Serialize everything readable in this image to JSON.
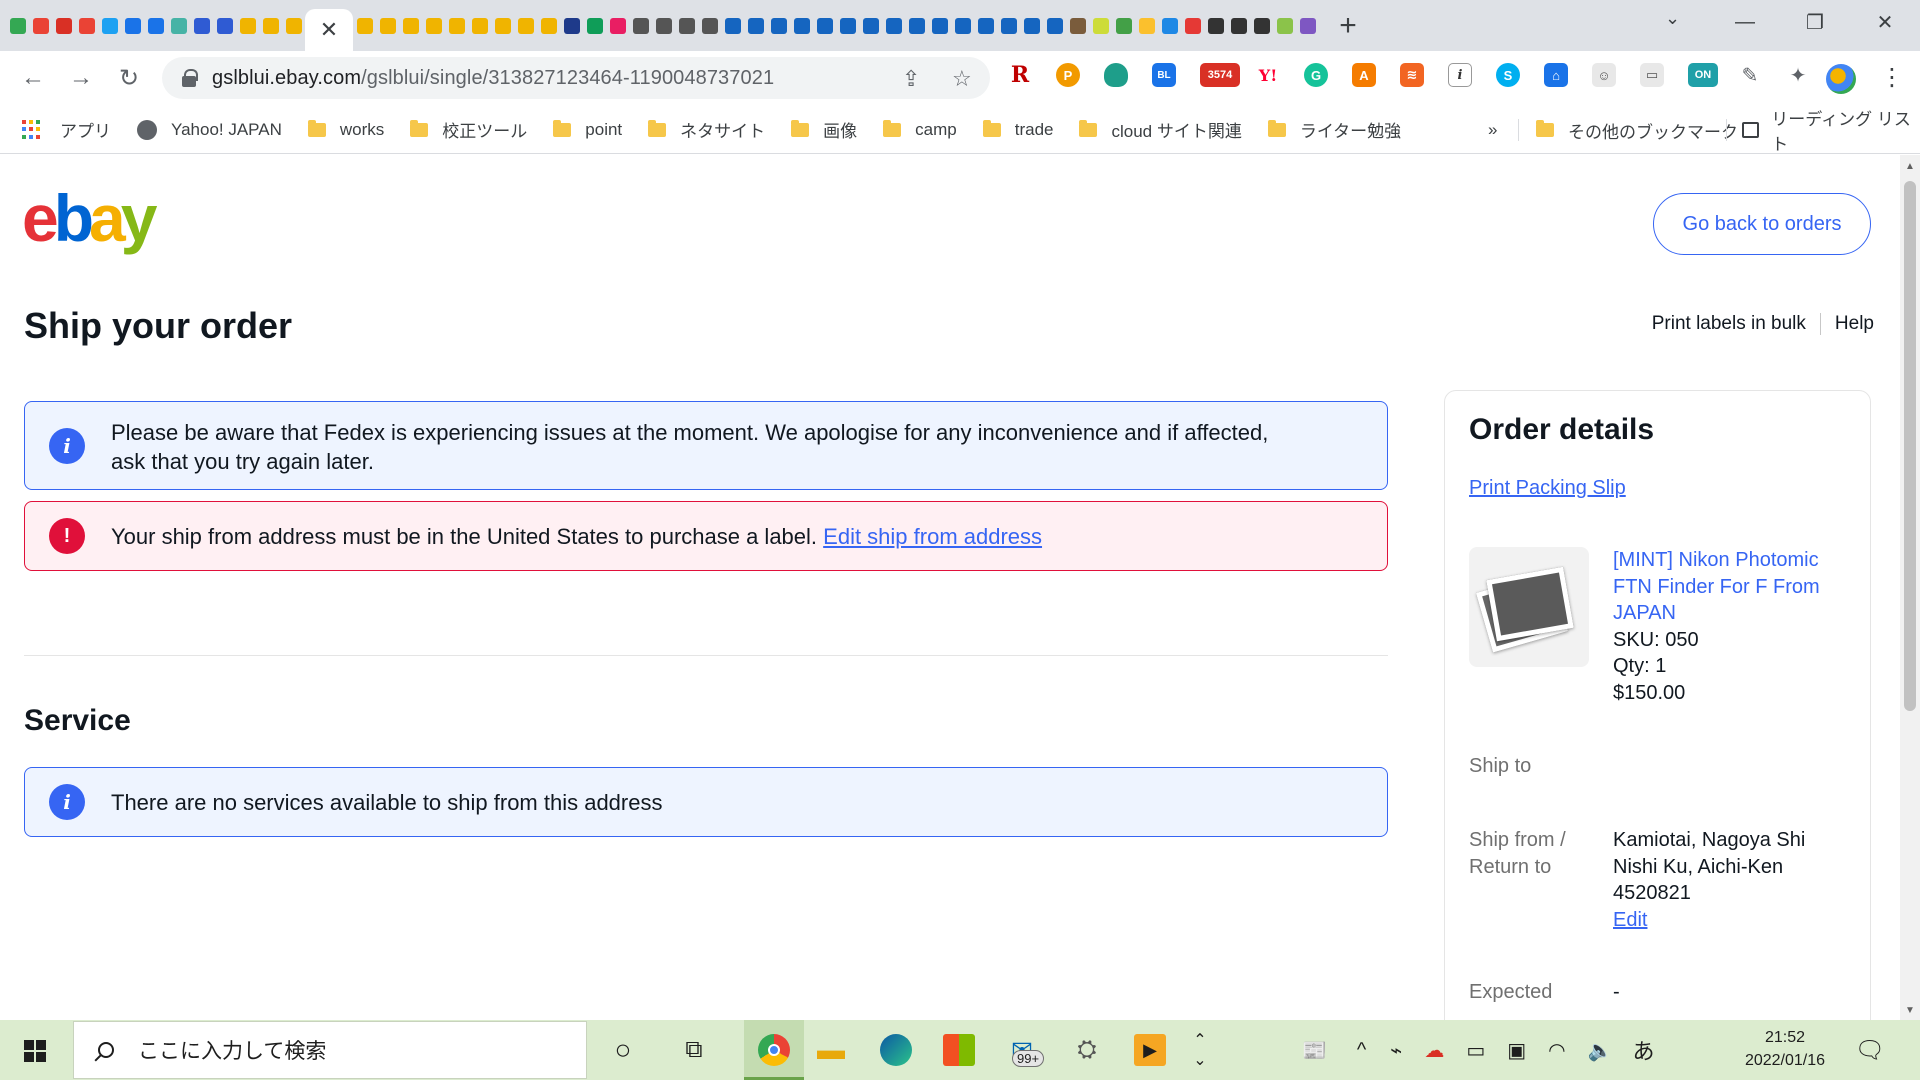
{
  "browser": {
    "active_tab_close": "✕",
    "new_tab": "+",
    "url_host": "gslblui.ebay.com",
    "url_path": "/gslblui/single/313827123464-1190048737021",
    "bookmarks": [
      {
        "label": "アプリ",
        "type": "apps"
      },
      {
        "label": "Yahoo! JAPAN",
        "type": "globe"
      },
      {
        "label": "works",
        "type": "folder"
      },
      {
        "label": "校正ツール",
        "type": "folder"
      },
      {
        "label": "point",
        "type": "folder"
      },
      {
        "label": "ネタサイト",
        "type": "folder"
      },
      {
        "label": "画像",
        "type": "folder"
      },
      {
        "label": "camp",
        "type": "folder"
      },
      {
        "label": "trade",
        "type": "folder"
      },
      {
        "label": "cloud サイト関連",
        "type": "folder"
      },
      {
        "label": "ライター勉強",
        "type": "folder"
      }
    ],
    "bookmarks_more": "»",
    "other_bookmarks": "その他のブックマーク",
    "reading_list": "リーディング リスト",
    "extension_badges": {
      "mail_count": "3574",
      "on_label": "ON"
    }
  },
  "page": {
    "logo": {
      "e": "e",
      "b": "b",
      "a": "a",
      "y": "y"
    },
    "back_button": "Go back to orders",
    "title": "Ship your order",
    "header_links": {
      "print_bulk": "Print labels in bulk",
      "help": "Help"
    },
    "notices": {
      "fedex": "Please be aware that Fedex is experiencing issues at the moment. We apologise for any inconvenience and if affected, ask that you try again later.",
      "address_error": "Your ship from address must be in the United States to purchase a label.",
      "address_error_link": "Edit ship from address",
      "no_services": "There are no services available to ship from this address"
    },
    "service_title": "Service",
    "icons": {
      "info": "i",
      "error": "!"
    }
  },
  "order_details": {
    "title": "Order details",
    "print_packing_slip": "Print Packing Slip",
    "item": {
      "title": "[MINT] Nikon Photomic FTN Finder For F From JAPAN",
      "sku": "SKU: 050",
      "qty": "Qty: 1",
      "price": "$150.00"
    },
    "ship_to_label": "Ship to",
    "ship_from_label": "Ship from / Return to",
    "ship_from_lines": [
      "Kamiotai, Nagoya Shi",
      "Nishi Ku, Aichi-Ken",
      "4520821"
    ],
    "edit_link": "Edit",
    "expected_label": "Expected",
    "expected_value": "-"
  },
  "taskbar": {
    "search_placeholder": "ここに入力して検索",
    "mail_badge": "99+",
    "ime": "あ",
    "time": "21:52",
    "date": "2022/01/16"
  },
  "colors": {
    "ebay_red": "#e53238",
    "ebay_blue": "#0064d2",
    "ebay_yellow": "#f5af02",
    "ebay_green": "#86b817",
    "link_blue": "#3665f3",
    "error_red": "#e0103a",
    "taskbar_green": "#dceccf"
  }
}
